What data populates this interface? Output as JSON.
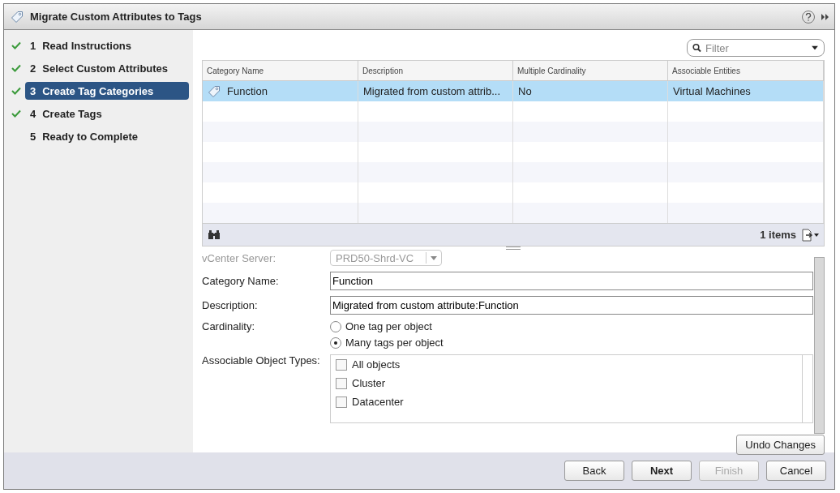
{
  "window": {
    "title": "Migrate Custom Attributes to Tags"
  },
  "steps": [
    {
      "number": "1",
      "label": "Read Instructions",
      "done": true,
      "selected": false
    },
    {
      "number": "2",
      "label": "Select Custom Attributes",
      "done": true,
      "selected": false
    },
    {
      "number": "3",
      "label": "Create Tag Categories",
      "done": true,
      "selected": true
    },
    {
      "number": "4",
      "label": "Create Tags",
      "done": true,
      "selected": false
    },
    {
      "number": "5",
      "label": "Ready to Complete",
      "done": false,
      "selected": false
    }
  ],
  "filter": {
    "placeholder": "Filter"
  },
  "table": {
    "columns": [
      "Category Name",
      "Description",
      "Multiple Cardinality",
      "Associable Entities"
    ],
    "rows": [
      {
        "cells": [
          "Function",
          "Migrated from custom attrib...",
          "No",
          "Virtual Machines"
        ],
        "selected": true
      }
    ],
    "count": "1 items"
  },
  "form": {
    "vcenter": {
      "label": "vCenter Server:",
      "value": "PRD50-Shrd-VC",
      "disabled": true
    },
    "category_name": {
      "label": "Category Name:",
      "value": "Function"
    },
    "description": {
      "label": "Description:",
      "value": "Migrated from custom attribute:Function"
    },
    "cardinality": {
      "label": "Cardinality:",
      "options": [
        {
          "label": "One tag per object",
          "selected": false
        },
        {
          "label": "Many tags per object",
          "selected": true
        }
      ]
    },
    "object_types": {
      "label": "Associable Object Types:",
      "items": [
        {
          "label": "All objects",
          "checked": false
        },
        {
          "label": "Cluster",
          "checked": false
        },
        {
          "label": "Datacenter",
          "checked": false
        }
      ]
    },
    "undo": "Undo Changes"
  },
  "buttons": [
    {
      "label": "Back",
      "kind": "normal",
      "disabled": false
    },
    {
      "label": "Next",
      "kind": "primary",
      "disabled": false
    },
    {
      "label": "Finish",
      "kind": "normal",
      "disabled": true
    },
    {
      "label": "Cancel",
      "kind": "normal",
      "disabled": false
    }
  ]
}
